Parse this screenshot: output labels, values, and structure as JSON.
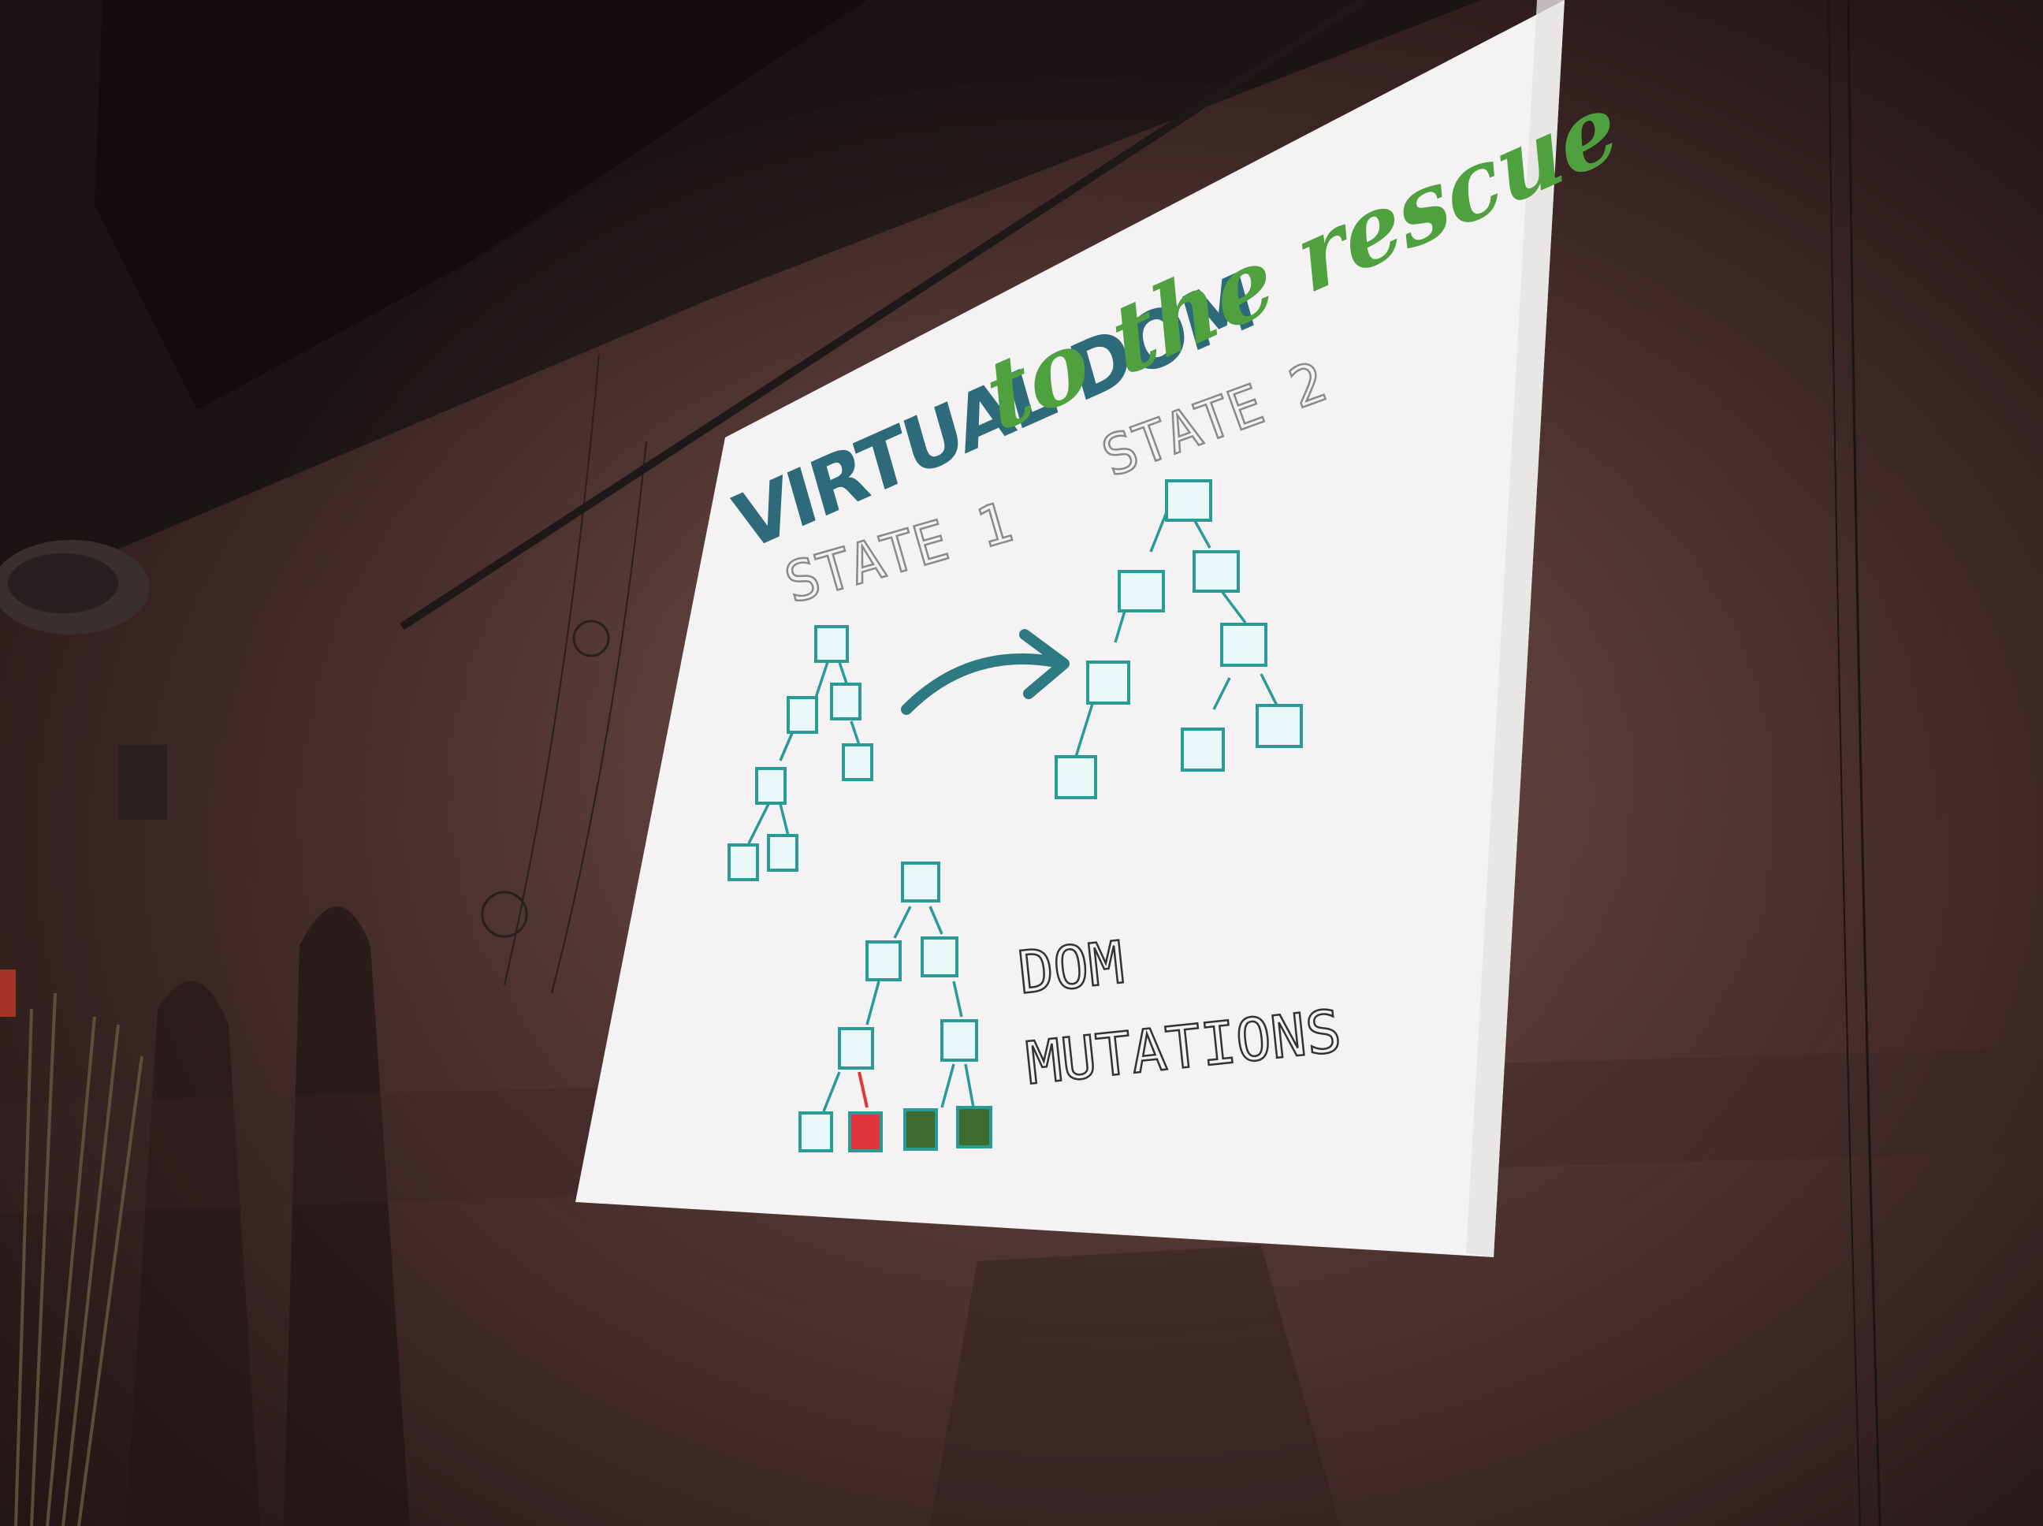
{
  "slide": {
    "title_part1": "VIRTUAL DOM",
    "title_part2": "to the rescue",
    "label_state1": "STATE 1",
    "label_state2": "STATE 2",
    "label_mutations_line1": "DOM",
    "label_mutations_line2": "MUTATIONS"
  },
  "colors": {
    "title_dark": "#2e6b7a",
    "title_green": "#4fa13f",
    "node_border": "#2a9a96",
    "node_fill": "#e9f7f7",
    "removed_node": "#e0353d",
    "added_node": "#3e6b2e",
    "transition_arrow": "#2e7a82"
  },
  "icons": {
    "transition": "curved-arrow-icon"
  }
}
